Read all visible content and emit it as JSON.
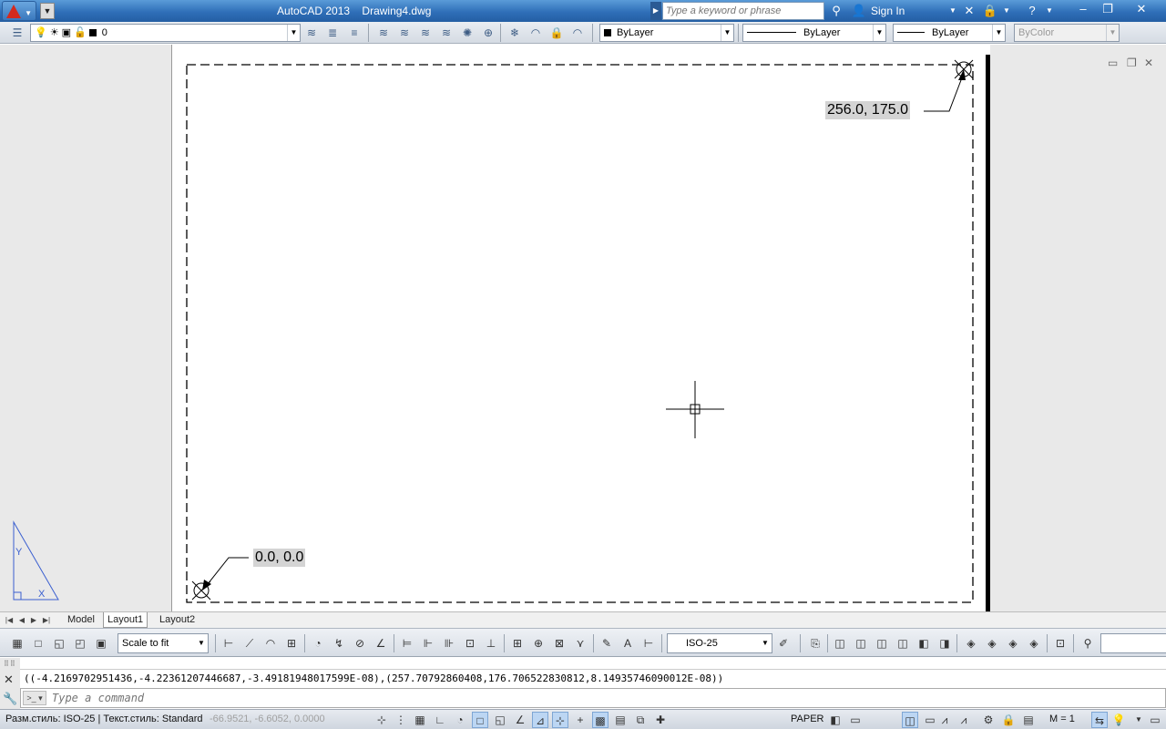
{
  "window": {
    "app_title": "AutoCAD 2013",
    "doc_title": "Drawing4.dwg",
    "search_placeholder": "Type a keyword or phrase",
    "sign_in": "Sign In"
  },
  "toolbar": {
    "layer_name": "0",
    "color_value": "ByLayer",
    "linetype_value": "ByLayer",
    "lineweight_value": "ByLayer",
    "plotstyle_value": "ByColor"
  },
  "drawing": {
    "label_top_right": "256.0, 175.0",
    "label_bottom_left": "0.0, 0.0",
    "ucs_y": "Y",
    "ucs_x": "X"
  },
  "tabs": {
    "model": "Model",
    "layout1": "Layout1",
    "layout2": "Layout2"
  },
  "toolbar2": {
    "scale_value": "Scale to fit",
    "dimstyle_value": "ISO-25"
  },
  "command": {
    "history": "((-4.2169702951436,-4.22361207446687,-3.49181948017599E-08),(257.70792860408,176.706522830812,8.14935746090012E-08))",
    "placeholder": "Type a command"
  },
  "status": {
    "styles_text": "Разм.стиль: ISO-25 | Текст.стиль: Standard",
    "coords": "-66.9521, -6.6052, 0.0000",
    "paper": "PAPER",
    "scale": "M = 1"
  },
  "colors": {
    "titlebar": "#2f6fb8",
    "paper_background": "#e9e9e9",
    "ucs_icon": "#3a5fd0",
    "label_background": "#d4d4d4"
  }
}
